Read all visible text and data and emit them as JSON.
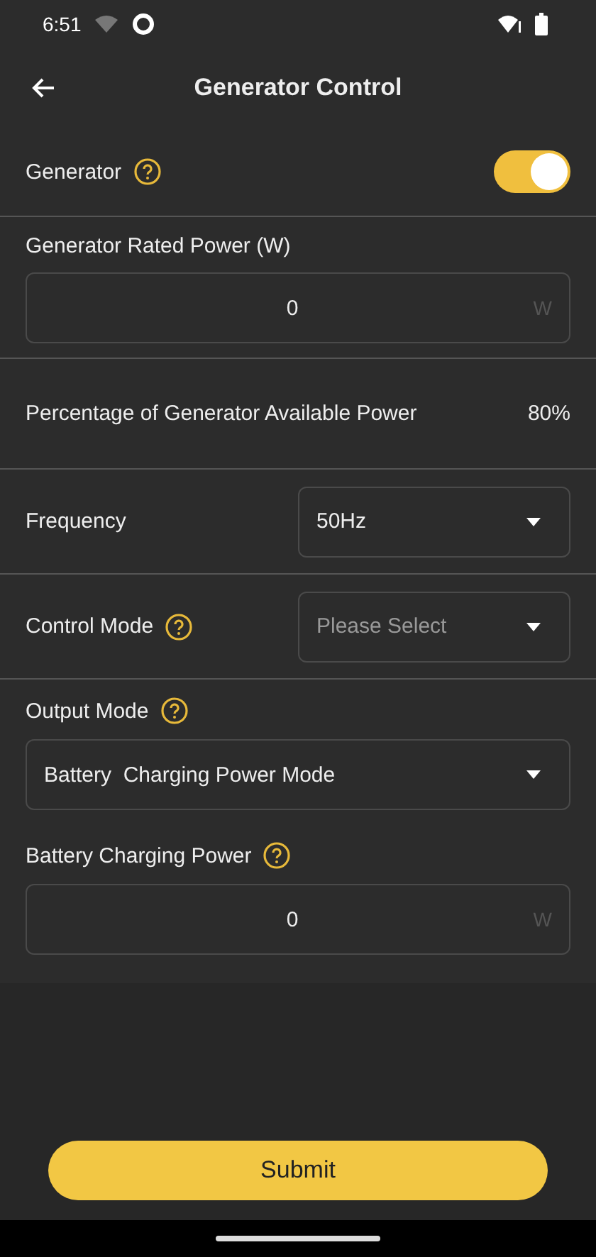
{
  "status_bar": {
    "time": "6:51"
  },
  "header": {
    "title": "Generator Control"
  },
  "sections": [
    [
      {
        "kind": "toggle",
        "label": "Generator",
        "help": true,
        "on": true
      }
    ],
    [
      {
        "kind": "input",
        "label": "Generator Rated Power (W)",
        "help": false,
        "value": "0",
        "unit": "W"
      }
    ],
    [
      {
        "kind": "info",
        "label": "Percentage of Generator Available Power",
        "value": "80%"
      }
    ],
    [
      {
        "kind": "select_inline",
        "label": "Frequency",
        "help": false,
        "value": "50Hz"
      }
    ],
    [
      {
        "kind": "select_inline",
        "label": "Control Mode",
        "help": true,
        "placeholder": "Please Select"
      }
    ],
    [
      {
        "kind": "select_block",
        "label": "Output Mode",
        "help": true,
        "value": "Battery  Charging Power Mode"
      },
      {
        "kind": "input",
        "label": "Battery Charging Power",
        "help": true,
        "value": "0",
        "unit": "W"
      }
    ]
  ],
  "submit": {
    "label": "Submit"
  }
}
